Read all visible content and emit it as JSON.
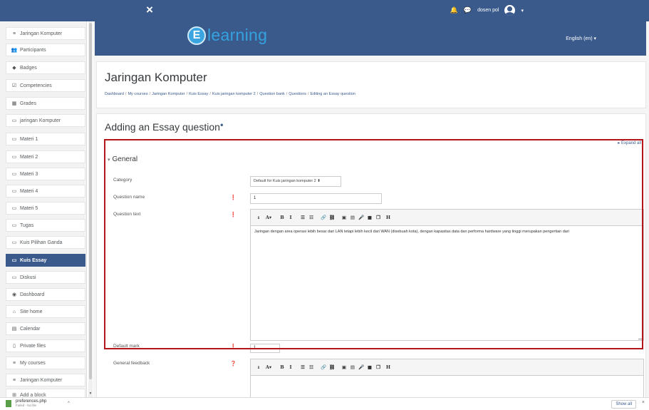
{
  "navbar": {
    "close_icon": "×",
    "bell_icon": "🔔",
    "chat_icon": "💬",
    "user_name": "dosen pol",
    "user_caret": "▾"
  },
  "sidebar": {
    "items": [
      {
        "icon": "≡",
        "label": "Jaringan Komputer"
      },
      {
        "icon": "👥",
        "label": "Participants"
      },
      {
        "icon": "◆",
        "label": "Badges"
      },
      {
        "icon": "☑",
        "label": "Competencies"
      },
      {
        "icon": "▦",
        "label": "Grades"
      },
      {
        "icon": "▭",
        "label": "jaringan Komputer"
      },
      {
        "icon": "▭",
        "label": "Materi 1"
      },
      {
        "icon": "▭",
        "label": "Materi 2"
      },
      {
        "icon": "▭",
        "label": "Materi 3"
      },
      {
        "icon": "▭",
        "label": "Materi 4"
      },
      {
        "icon": "▭",
        "label": "Materi 5"
      },
      {
        "icon": "▭",
        "label": "Tugas"
      },
      {
        "icon": "▭",
        "label": "Kuis Pilihan Ganda"
      },
      {
        "icon": "▭",
        "label": "Kuis Essay"
      },
      {
        "icon": "▭",
        "label": "Diskusi"
      },
      {
        "icon": "◉",
        "label": "Dashboard"
      },
      {
        "icon": "⌂",
        "label": "Site home"
      },
      {
        "icon": "▤",
        "label": "Calendar"
      },
      {
        "icon": "▯",
        "label": "Private files"
      },
      {
        "icon": "≡",
        "label": "My courses"
      },
      {
        "icon": "≡",
        "label": "Jaringan Komputer"
      },
      {
        "icon": "⊞",
        "label": "Add a block"
      }
    ],
    "active_index": 13
  },
  "banner": {
    "logo_letter": "E",
    "logo_text": "learning",
    "language": "English (en) ▾"
  },
  "header": {
    "course_title": "Jaringan Komputer",
    "breadcrumbs": [
      "Dashboard",
      "My courses",
      "Jaringan Komputer",
      "Kuis Essay",
      "Kuis jaringan komputer 2",
      "Question bank",
      "Questions",
      "Editing an Essay question"
    ]
  },
  "form": {
    "page_heading": "Adding an Essay question",
    "expand_all": "▸ Expand all",
    "section_title": "General",
    "category_label": "Category",
    "category_value": "Default for Kuis jaringan komputer 2",
    "question_name_label": "Question name",
    "question_name_value": "1",
    "question_text_label": "Question text",
    "question_text_value": "Jaringan dengan area operasi lebih besar dari LAN tetapi lebih kecil dari WAN (disebuah kota), dengan kapasitas data dan performa hardware yang tinggi merupakan pengertian dari",
    "default_mark_label": "Default mark",
    "default_mark_value": "1",
    "general_feedback_label": "General feedback",
    "toolbar_buttons": [
      "ı",
      "A▾",
      "B",
      "I",
      "☰",
      "☷",
      "🔗",
      "⛓",
      "▣",
      "▤",
      "🎤",
      "■",
      "❐",
      "H"
    ]
  },
  "download_bar": {
    "file_name": "preferences.php",
    "file_status": "Failed - No file",
    "caret": "^",
    "show_all": "Show all",
    "close": "×"
  },
  "colors": {
    "brand": "#3a5a8c",
    "logo_accent": "#35a2e0",
    "required": "#c9302c",
    "highlight_box": "#b5161c"
  }
}
